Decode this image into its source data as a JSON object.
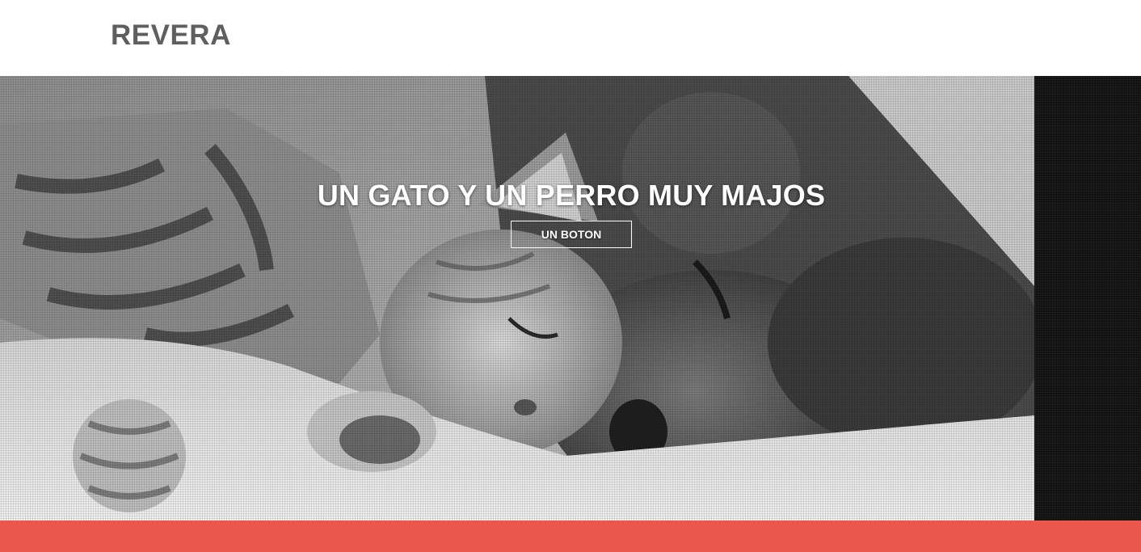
{
  "header": {
    "logo": "REVERA"
  },
  "hero": {
    "image_icon": "kitten-and-puppy-photo",
    "title": "UN GATO Y UN PERRO MUY MAJOS",
    "button_label": "UN BOTON"
  },
  "colors": {
    "logo": "#5f5f5f",
    "accent_bar": "#ea574d",
    "side_panel": "#111111",
    "hero_text": "#ffffff"
  }
}
